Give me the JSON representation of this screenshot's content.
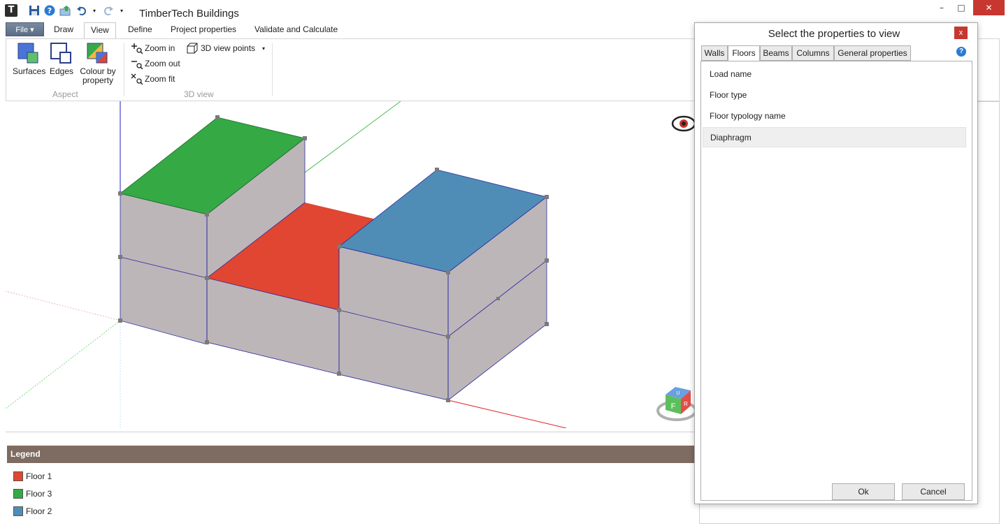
{
  "window": {
    "title": "TimberTech Buildings",
    "app_icon_letter": "T",
    "minimize": "–",
    "maximize": "□",
    "close": "✕"
  },
  "ribbon_tabs": {
    "file": "File ▾",
    "tabs": [
      "Draw",
      "View",
      "Define",
      "Project properties",
      "Validate and Calculate"
    ],
    "active": "View"
  },
  "ribbon": {
    "surfaces": "Surfaces",
    "edges": "Edges",
    "colour_by_property": "Colour by property",
    "aspect_group": "Aspect",
    "zoom_in": "Zoom in",
    "zoom_out": "Zoom out",
    "zoom_fit": "Zoom fit",
    "view_points": "3D view points",
    "view_group": "3D view"
  },
  "legend": {
    "header": "Legend",
    "items": [
      {
        "label": "Floor 1",
        "color": "#e04632"
      },
      {
        "label": "Floor 3",
        "color": "#34a944"
      },
      {
        "label": "Floor 2",
        "color": "#4f8db7"
      }
    ]
  },
  "view_cube": {
    "face_front": "F",
    "face_right": "R",
    "face_top": "U"
  },
  "dialog": {
    "title": "Select the properties to view",
    "close": "x",
    "help": "?",
    "tabs": [
      "Walls",
      "Floors",
      "Beams",
      "Columns",
      "General properties"
    ],
    "active_tab": "Floors",
    "properties": [
      "Load name",
      "Floor type",
      "Floor typology name",
      "Diaphragm"
    ],
    "selected_property": "Diaphragm",
    "ok": "Ok",
    "cancel": "Cancel"
  },
  "colors": {
    "wall_grey": "#bdb6b8",
    "floor1_red": "#e04632",
    "floor3_green": "#34a944",
    "floor2_blue": "#4f8db7",
    "legend_header": "#7e6b61"
  }
}
